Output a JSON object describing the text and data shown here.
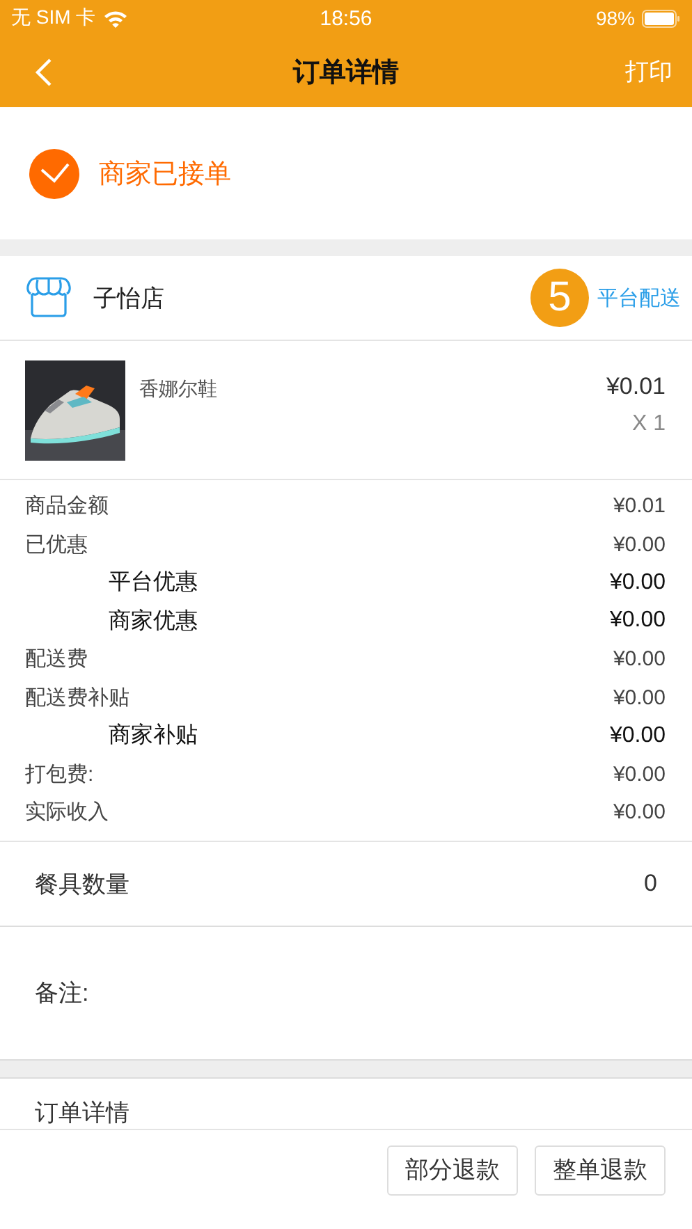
{
  "status_bar": {
    "carrier": "无 SIM 卡",
    "time": "18:56",
    "battery": "98%"
  },
  "nav": {
    "title": "订单详情",
    "action": "打印"
  },
  "order_status": {
    "text": "商家已接单",
    "done": true
  },
  "shop": {
    "name": "子怡店",
    "badge": "5",
    "delivery": "平台配送"
  },
  "item": {
    "name": "香娜尔鞋",
    "price": "¥0.01",
    "quantity": "X 1"
  },
  "fees": [
    {
      "kind": "main",
      "label": "商品金额",
      "value": "¥0.01"
    },
    {
      "kind": "main",
      "label": "已优惠",
      "value": "¥0.00"
    },
    {
      "kind": "sub",
      "label": "平台优惠",
      "value": "¥0.00"
    },
    {
      "kind": "sub",
      "label": "商家优惠",
      "value": "¥0.00"
    },
    {
      "kind": "main",
      "label": "配送费",
      "value": "¥0.00"
    },
    {
      "kind": "main",
      "label": "配送费补贴",
      "value": "¥0.00"
    },
    {
      "kind": "sub",
      "label": "商家补贴",
      "value": "¥0.00"
    },
    {
      "kind": "main",
      "label": "打包费:",
      "value": "¥0.00"
    },
    {
      "kind": "main",
      "label": "实际收入",
      "value": "¥0.00"
    }
  ],
  "tableware": {
    "label": "餐具数量",
    "value": "0"
  },
  "remark": {
    "label": "备注:"
  },
  "details_section": {
    "title": "订单详情"
  },
  "buttons": [
    "部分退款",
    "整单退款"
  ]
}
